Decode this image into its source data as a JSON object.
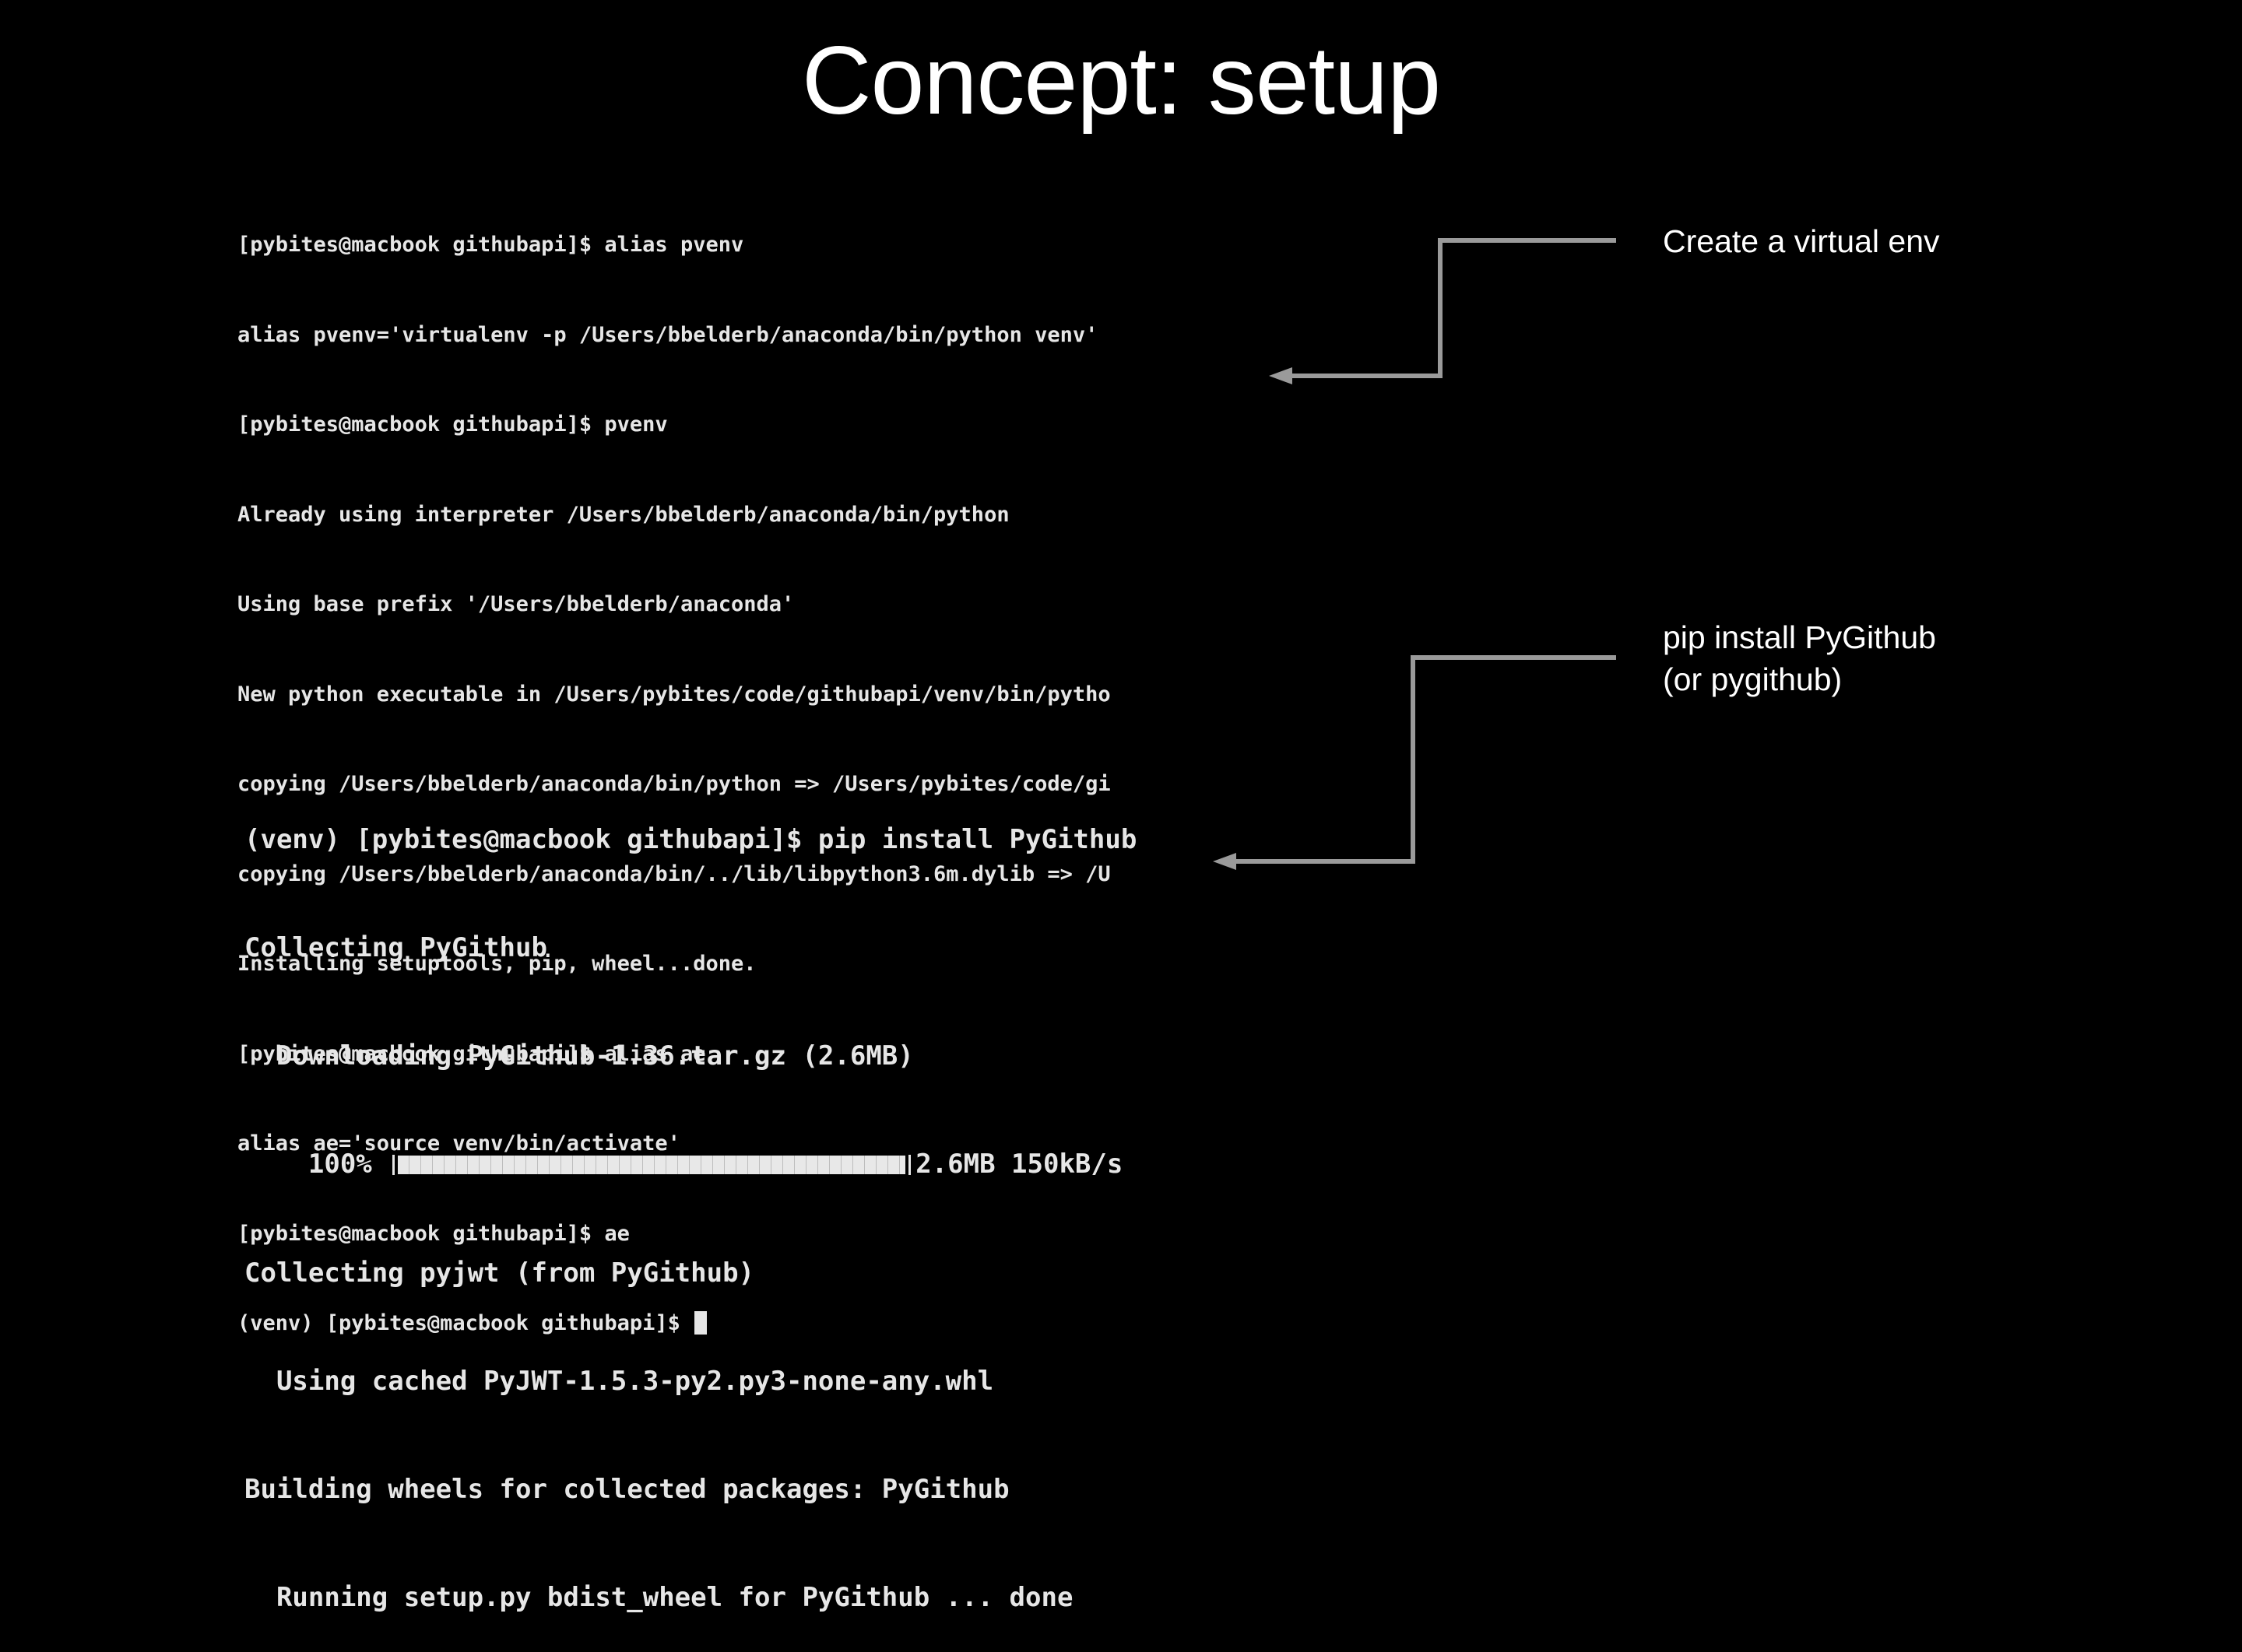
{
  "slide": {
    "title": "Concept: setup"
  },
  "terminal_virtualenv": {
    "lines": [
      "[pybites@macbook githubapi]$ alias pvenv",
      "alias pvenv='virtualenv -p /Users/bbelderb/anaconda/bin/python venv'",
      "[pybites@macbook githubapi]$ pvenv",
      "Already using interpreter /Users/bbelderb/anaconda/bin/python",
      "Using base prefix '/Users/bbelderb/anaconda'",
      "New python executable in /Users/pybites/code/githubapi/venv/bin/pytho",
      "copying /Users/bbelderb/anaconda/bin/python => /Users/pybites/code/gi",
      "copying /Users/bbelderb/anaconda/bin/../lib/libpython3.6m.dylib => /U",
      "Installing setuptools, pip, wheel...done.",
      "[pybites@macbook githubapi]$ alias ae",
      "alias ae='source venv/bin/activate'",
      "[pybites@macbook githubapi]$ ae",
      "(venv) [pybites@macbook githubapi]$ "
    ]
  },
  "terminal_pip": {
    "lines_before": [
      "(venv) [pybites@macbook githubapi]$ pip install PyGithub",
      "Collecting PyGithub",
      "  Downloading PyGithub-1.36.tar.gz (2.6MB)"
    ],
    "progress": {
      "percent_label": "    100% ",
      "fraction": 1.0,
      "size_speed": "2.6MB 150kB/s"
    },
    "lines_after": [
      "Collecting pyjwt (from PyGithub)",
      "  Using cached PyJWT-1.5.3-py2.py3-none-any.whl",
      "Building wheels for collected packages: PyGithub",
      "  Running setup.py bdist_wheel for PyGithub ... done"
    ]
  },
  "annotations": {
    "virtualenv": "Create a virtual env",
    "pip": "pip install PyGithub\n(or pygithub)"
  },
  "colors": {
    "background": "#000000",
    "text": "#ffffff",
    "terminal_text": "#e6e6e6",
    "arrow": "#9a9a9a"
  }
}
